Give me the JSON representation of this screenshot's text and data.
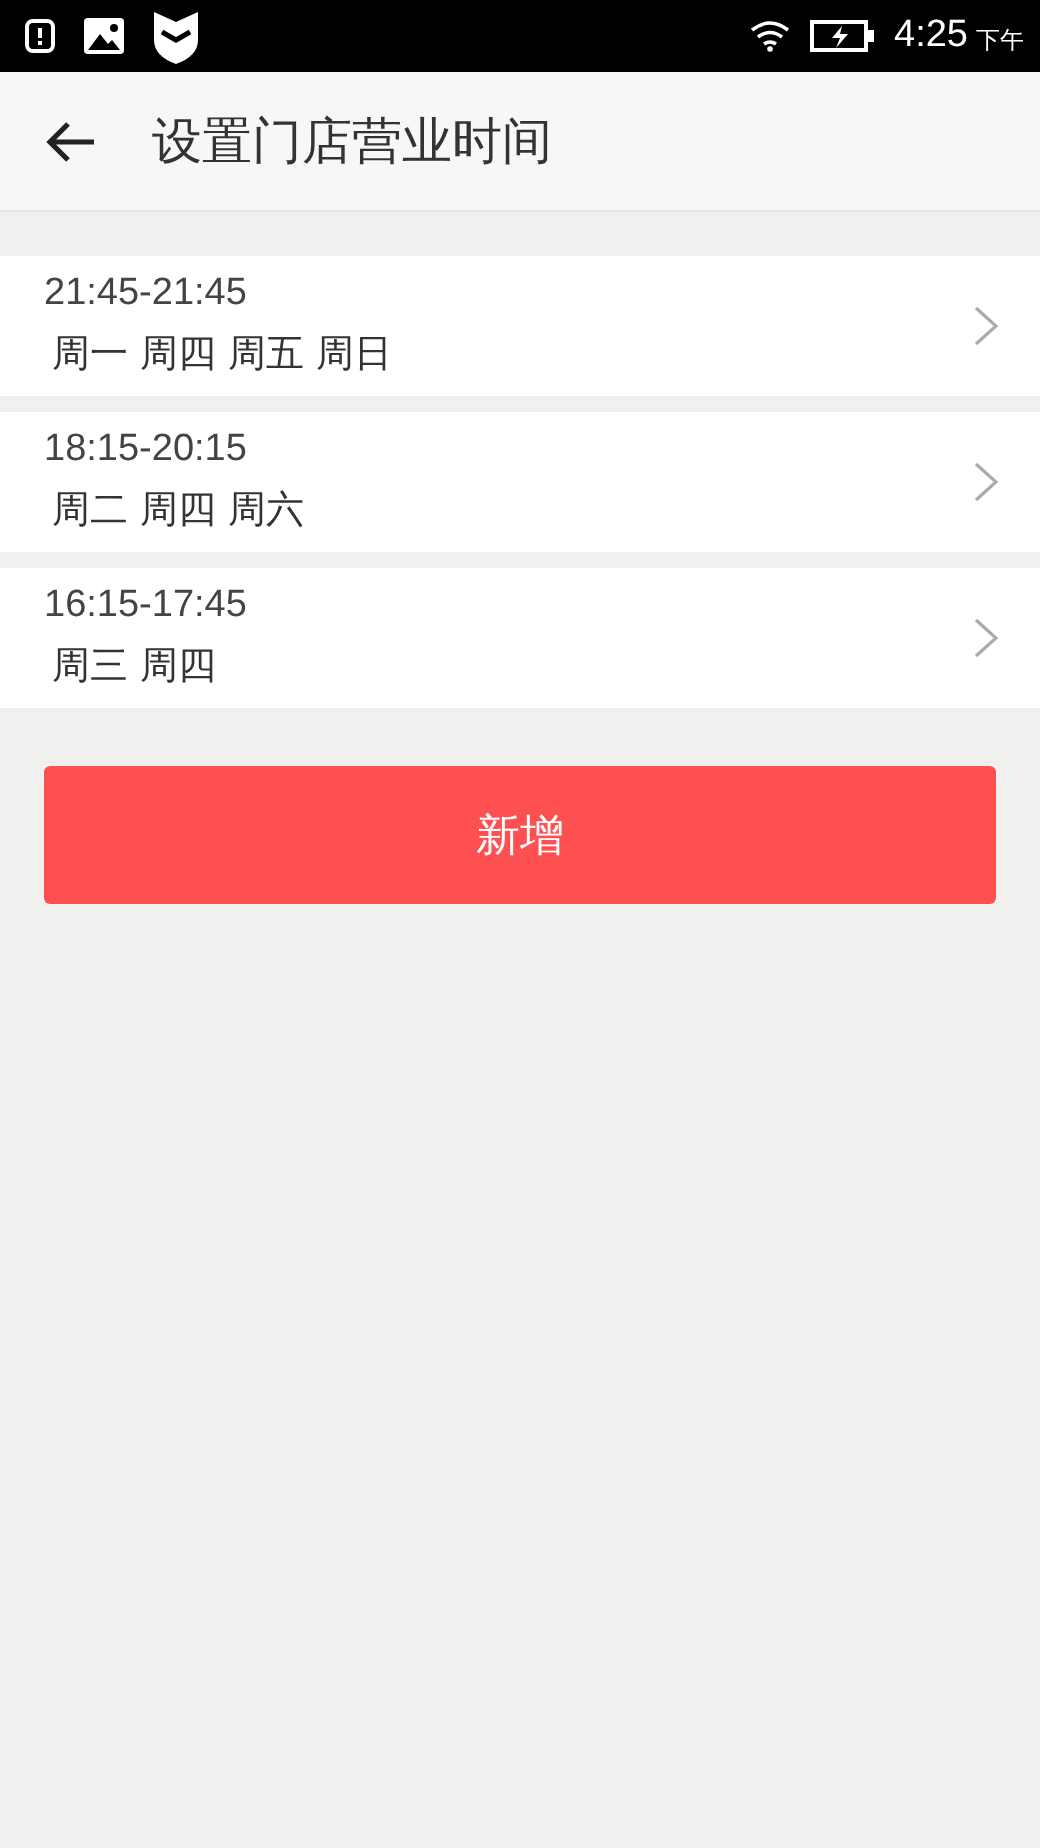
{
  "status_bar": {
    "time": "4:25",
    "period": "下午"
  },
  "header": {
    "title": "设置门店营业时间"
  },
  "schedules": [
    {
      "hours": "21:45-21:45",
      "days": "周一 周四 周五 周日"
    },
    {
      "hours": "18:15-20:15",
      "days": "周二 周四 周六"
    },
    {
      "hours": "16:15-17:45",
      "days": "周三 周四"
    }
  ],
  "add_button": {
    "label": "新增"
  }
}
